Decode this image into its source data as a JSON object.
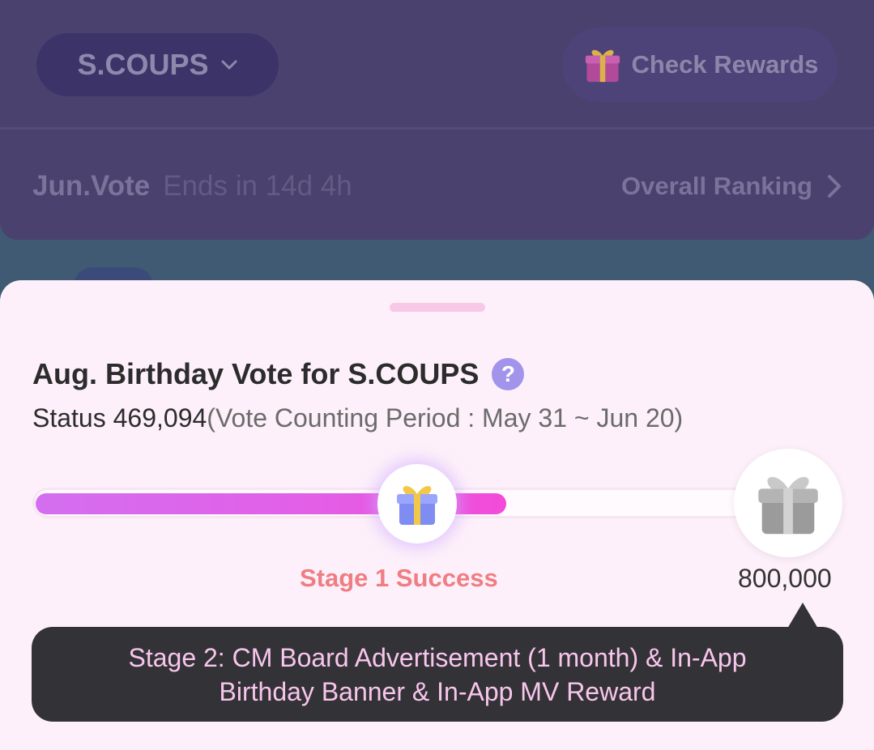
{
  "background": {
    "artist_selector": {
      "label": "S.COUPS"
    },
    "check_rewards": {
      "label": "Check Rewards"
    },
    "vote": {
      "title": "Jun.Vote",
      "ends": "Ends in 14d 4h"
    },
    "ranking_link": {
      "label": "Overall Ranking"
    }
  },
  "sheet": {
    "title": "Aug. Birthday Vote for S.COUPS",
    "help_icon_text": "?",
    "status_label": "Status",
    "status_value": "469,094",
    "period_text": "(Vote Counting Period : May 31 ~ Jun 20)",
    "progress": {
      "current": 469094,
      "goal": 800000
    },
    "stage1_label": "Stage 1 Success",
    "goal_label": "800,000",
    "tooltip": "Stage 2: CM Board Advertisement (1 month) & In-App Birthday Banner & In-App MV Reward"
  },
  "icons": {
    "chevron_down": "chevron-down-icon",
    "chevron_right": "chevron-right-icon",
    "gift_color": "gift-icon",
    "gift_gray": "gift-locked-icon"
  },
  "colors": {
    "accent_pink": "#f24bd8",
    "accent_purple": "#d46ef0",
    "success_label": "#ef7d82",
    "help_icon": "#a294ea",
    "tooltip_bg": "#333237",
    "tooltip_text": "#f8c6ec"
  }
}
